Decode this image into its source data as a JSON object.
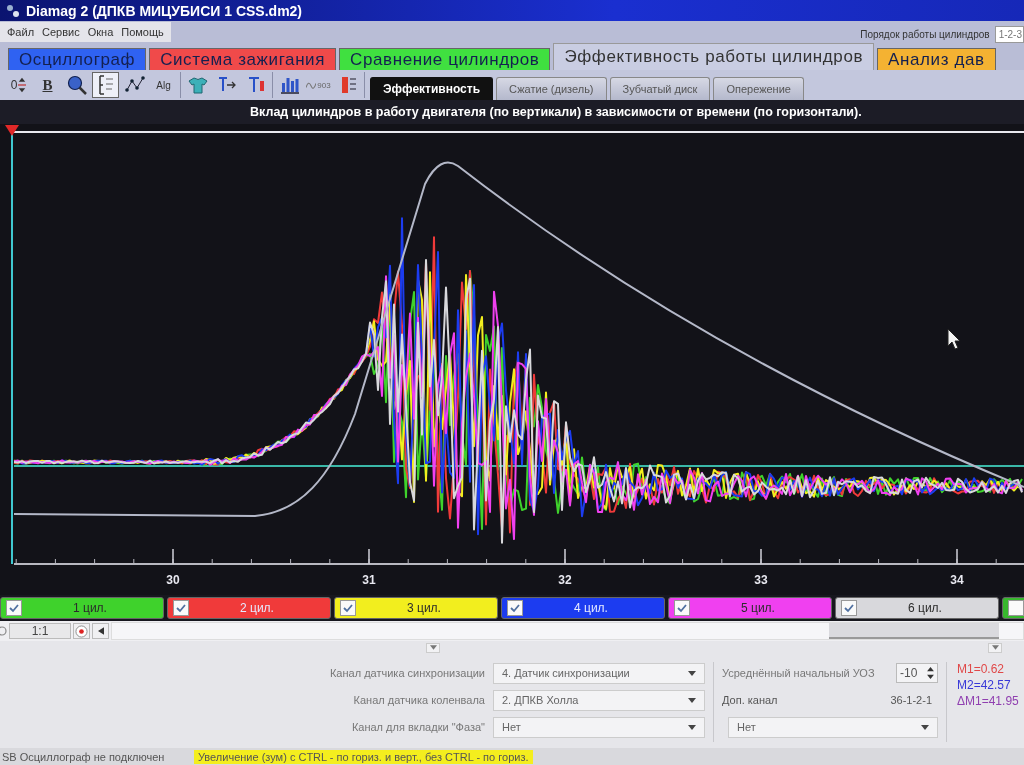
{
  "window": {
    "title": "Diamag 2 (ДПКВ МИЦУБИСИ 1 CSS.dm2)"
  },
  "menu": [
    "Файл",
    "Сервис",
    "Окна",
    "Помощь"
  ],
  "firing_order": {
    "label": "Порядок работы цилиндров",
    "value": "1-2-3"
  },
  "tabs": [
    {
      "label": "Осциллограф",
      "color": "#2f62f2",
      "selected": false
    },
    {
      "label": "Система зажигания",
      "color": "#f04a4a",
      "selected": false
    },
    {
      "label": "Сравнение цилиндров",
      "color": "#40e040",
      "selected": false
    },
    {
      "label": "Эффективность работы цилиндров",
      "color": "#c9cde2",
      "selected": true
    },
    {
      "label": "Анализ дав",
      "color": "#f4b232",
      "selected": false
    }
  ],
  "toolbar_groups": [
    {
      "tools": [
        {
          "kind": "level",
          "glyph": "0",
          "pressed": false
        },
        {
          "kind": "bold",
          "glyph": "B",
          "pressed": false
        },
        {
          "kind": "magnifier",
          "pressed": false
        },
        {
          "kind": "ruler",
          "pressed": true
        },
        {
          "kind": "scatter",
          "pressed": false
        },
        {
          "kind": "algorithm",
          "glyph": "Alg",
          "pressed": false
        }
      ]
    },
    {
      "tools": [
        {
          "kind": "shirt",
          "pressed": false
        },
        {
          "kind": "pin-arrow",
          "pressed": false
        },
        {
          "kind": "pin",
          "pressed": false
        }
      ]
    },
    {
      "tools": [
        {
          "kind": "bars",
          "pressed": false
        },
        {
          "kind": "wave",
          "glyph": "903",
          "pressed": false
        },
        {
          "kind": "meter",
          "pressed": false
        }
      ]
    }
  ],
  "subtabs": [
    {
      "label": "Эффективность",
      "selected": true
    },
    {
      "label": "Сжатие (дизель)",
      "selected": false
    },
    {
      "label": "Зубчатый диск",
      "selected": false
    },
    {
      "label": "Опережение",
      "selected": false
    }
  ],
  "chart": {
    "title": "Вклад цилиндров в работу двигателя (по вертикали) в зависимости от времени (по горизонтали).",
    "x_tick_labels": [
      "30",
      "31",
      "32",
      "33",
      "34"
    ]
  },
  "cylinders": [
    {
      "label": "1 цил.",
      "color": "#3fd22c",
      "checked": true
    },
    {
      "label": "2 цил.",
      "color": "#f03a3a",
      "checked": true
    },
    {
      "label": "3 цил.",
      "color": "#f2ee1e",
      "checked": true
    },
    {
      "label": "4 цил.",
      "color": "#1c3cf0",
      "checked": true
    },
    {
      "label": "5 цил.",
      "color": "#f040f0",
      "checked": true
    },
    {
      "label": "6 цил.",
      "color": "#d8d8dc",
      "checked": true
    }
  ],
  "legend_overflow": {
    "color": "#38b82e",
    "checked": false
  },
  "zoom": {
    "value": "1:1"
  },
  "settings": {
    "rows": [
      {
        "label": "Канал датчика синхронизации",
        "value": "4. Датчик синхронизации"
      },
      {
        "label": "Канал датчика коленвала",
        "value": "2. ДПКВ Холла"
      },
      {
        "label": "Канал для вкладки \"Фаза\"",
        "value": "Нет"
      }
    ],
    "uoz": {
      "label": "Усреднённый начальный УОЗ",
      "value": "-10"
    },
    "extra_channel": {
      "label": "Доп. канал",
      "pattern": "36-1-2-1",
      "value": "Нет"
    }
  },
  "markers": [
    {
      "text": "M1=0.62",
      "color": "#e04848"
    },
    {
      "text": "M2=42.57",
      "color": "#3838d8"
    },
    {
      "text": "ΔM1=41.95",
      "color": "#9040b0"
    }
  ],
  "status_bar": {
    "connection": "SB Осциллограф не подключен",
    "hint": "Увеличение (зум) с CTRL - по гориз. и верт., без CTRL - по гориз."
  }
}
